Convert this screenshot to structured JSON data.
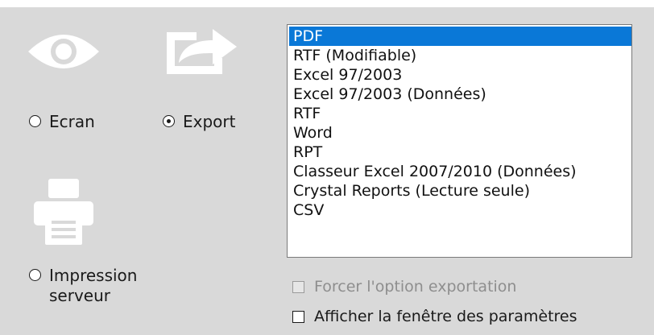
{
  "output_modes": {
    "screen_label": "Ecran",
    "export_label": "Export",
    "server_print_label_line1": "Impression",
    "server_print_label_line2": "serveur",
    "selected": "export"
  },
  "export_formats": {
    "items": [
      "PDF",
      "RTF (Modifiable)",
      "Excel 97/2003",
      "Excel 97/2003 (Données)",
      "RTF",
      "Word",
      "RPT",
      "Classeur Excel 2007/2010 (Données)",
      "Crystal Reports (Lecture seule)",
      "CSV"
    ],
    "selected": "PDF"
  },
  "options": {
    "force_export_label": "Forcer l'option exportation",
    "show_params_label": "Afficher la fenêtre des paramètres"
  },
  "icons": {
    "screen": "eye-icon",
    "export": "share-export-icon",
    "print": "printer-icon"
  },
  "colors": {
    "background": "#d9d9d9",
    "icon": "#ffffff",
    "selection": "#0a78d7"
  }
}
